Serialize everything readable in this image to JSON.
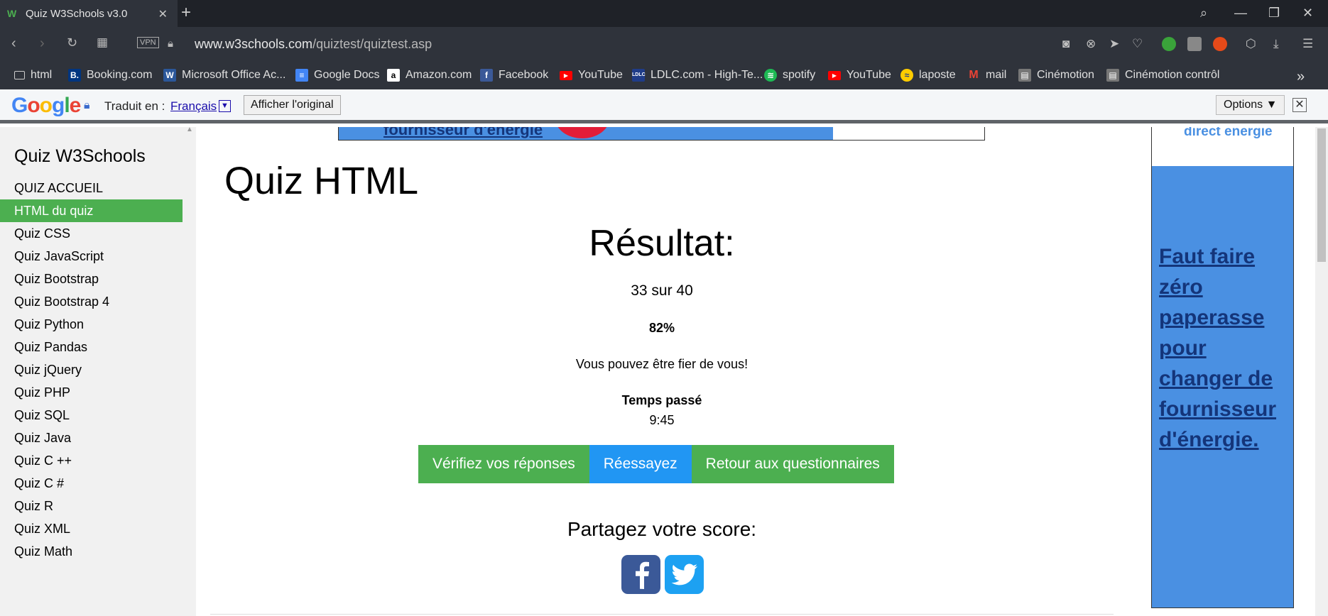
{
  "browser": {
    "tab_title": "Quiz W3Schools v3.0",
    "url_domain": "www.w3schools.com",
    "url_path": "/quiztest/quiztest.asp",
    "vpn_label": "VPN"
  },
  "bookmarks": [
    {
      "label": "html",
      "icon": "folder-icon"
    },
    {
      "label": "Booking.com",
      "icon": "booking-icon",
      "color": "#003580"
    },
    {
      "label": "Microsoft Office Ac...",
      "icon": "word-icon",
      "color": "#2b579a"
    },
    {
      "label": "Google Docs",
      "icon": "docs-icon",
      "color": "#4285f4"
    },
    {
      "label": "Amazon.com",
      "icon": "amazon-icon",
      "color": "#ffffff"
    },
    {
      "label": "Facebook",
      "icon": "facebook-icon",
      "color": "#3b5998"
    },
    {
      "label": "YouTube",
      "icon": "youtube-icon",
      "color": "#ff0000"
    },
    {
      "label": "LDLC.com - High-Te...",
      "icon": "ldlc-icon",
      "color": "#1f3c88"
    },
    {
      "label": "spotify",
      "icon": "spotify-icon",
      "color": "#1db954"
    },
    {
      "label": "YouTube",
      "icon": "youtube-icon",
      "color": "#ff0000"
    },
    {
      "label": "laposte",
      "icon": "laposte-icon",
      "color": "#ffcc00"
    },
    {
      "label": "mail",
      "icon": "gmail-icon",
      "color": "#ea4335"
    },
    {
      "label": "Cinémotion",
      "icon": "cinemotion-icon",
      "color": "#777777"
    },
    {
      "label": "Cinémotion contrôl",
      "icon": "cinemotion-icon",
      "color": "#777777"
    }
  ],
  "translate_bar": {
    "logo": "Google",
    "label": "Traduit en :",
    "language": "Français",
    "show_original": "Afficher l'original",
    "options": "Options ▼"
  },
  "sidebar": {
    "title": "Quiz W3Schools",
    "items": [
      {
        "label": "QUIZ ACCUEIL",
        "active": false
      },
      {
        "label": "HTML du quiz",
        "active": true
      },
      {
        "label": "Quiz CSS",
        "active": false
      },
      {
        "label": "Quiz JavaScript",
        "active": false
      },
      {
        "label": "Quiz Bootstrap",
        "active": false
      },
      {
        "label": "Quiz Bootstrap 4",
        "active": false
      },
      {
        "label": "Quiz Python",
        "active": false
      },
      {
        "label": "Quiz Pandas",
        "active": false
      },
      {
        "label": "Quiz jQuery",
        "active": false
      },
      {
        "label": "Quiz PHP",
        "active": false
      },
      {
        "label": "Quiz SQL",
        "active": false
      },
      {
        "label": "Quiz Java",
        "active": false
      },
      {
        "label": "Quiz C ++",
        "active": false
      },
      {
        "label": "Quiz C #",
        "active": false
      },
      {
        "label": "Quiz R",
        "active": false
      },
      {
        "label": "Quiz XML",
        "active": false
      },
      {
        "label": "Quiz Math",
        "active": false
      }
    ]
  },
  "main": {
    "title": "Quiz HTML",
    "result_heading": "Résultat:",
    "score": "33 sur 40",
    "percent": "82%",
    "message": "Vous pouvez être fier de vous!",
    "time_label": "Temps passé",
    "time_value": "9:45",
    "buttons": {
      "check": "Vérifiez vos réponses",
      "retry": "Réessayez",
      "back": "Retour aux questionnaires"
    },
    "share_heading": "Partagez votre score:"
  },
  "ads": {
    "top_banner_text": "fournisseur d'énergie",
    "side_brand": "direct energie",
    "side_text": "Faut faire zéro paperasse pour changer de fournisseur d'énergie."
  },
  "colors": {
    "accent_green": "#4caf50",
    "accent_blue": "#2196f3",
    "ad_blue": "#4a90e2"
  }
}
